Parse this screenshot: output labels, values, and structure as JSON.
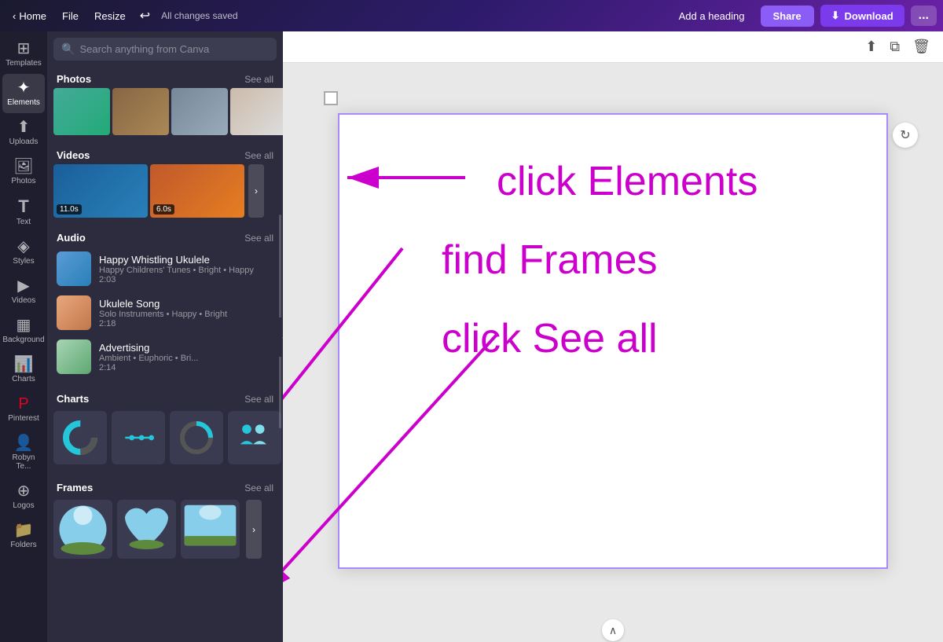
{
  "topbar": {
    "home_label": "Home",
    "file_label": "File",
    "resize_label": "Resize",
    "saved_label": "All changes saved",
    "add_heading_label": "Add a heading",
    "share_label": "Share",
    "download_label": "Download",
    "more_label": "..."
  },
  "sidebar": {
    "items": [
      {
        "id": "templates",
        "label": "Templates",
        "icon": "⊞"
      },
      {
        "id": "elements",
        "label": "Elements",
        "icon": "✦"
      },
      {
        "id": "uploads",
        "label": "Uploads",
        "icon": "↑"
      },
      {
        "id": "photos",
        "label": "Photos",
        "icon": "🖼"
      },
      {
        "id": "text",
        "label": "Text",
        "icon": "T"
      },
      {
        "id": "styles",
        "label": "Styles",
        "icon": "◈"
      },
      {
        "id": "videos",
        "label": "Videos",
        "icon": "▶"
      },
      {
        "id": "background",
        "label": "Background",
        "icon": "▦"
      },
      {
        "id": "charts",
        "label": "Charts",
        "icon": "📈"
      },
      {
        "id": "pinterest",
        "label": "Pinterest",
        "icon": "P"
      },
      {
        "id": "robyn",
        "label": "Robyn Te...",
        "icon": "👤"
      },
      {
        "id": "logos",
        "label": "Logos",
        "icon": "®"
      },
      {
        "id": "folders",
        "label": "Folders",
        "icon": "📁"
      }
    ]
  },
  "search": {
    "placeholder": "Search anything from Canva"
  },
  "panel": {
    "photos_title": "Photos",
    "photos_see_all": "See all",
    "videos_title": "Videos",
    "videos_see_all": "See all",
    "audio_title": "Audio",
    "audio_see_all": "See all",
    "charts_title": "Charts",
    "charts_see_all": "See all",
    "frames_title": "Frames",
    "frames_see_all": "See all",
    "audio_items": [
      {
        "title": "Happy Whistling Ukulele",
        "meta": "Happy Childrens' Tunes • Bright • Happy",
        "duration": "2:03"
      },
      {
        "title": "Ukulele Song",
        "meta": "Solo Instruments • Happy • Bright",
        "duration": "2:18"
      },
      {
        "title": "Advertising",
        "meta": "Ambient • Euphoric • Bri...",
        "duration": "2:14"
      }
    ],
    "video_durations": [
      "11.0s",
      "6.0s"
    ]
  },
  "annotations": {
    "click_elements": "click Elements",
    "find_frames": "find Frames",
    "click_see_all": "click See all"
  }
}
